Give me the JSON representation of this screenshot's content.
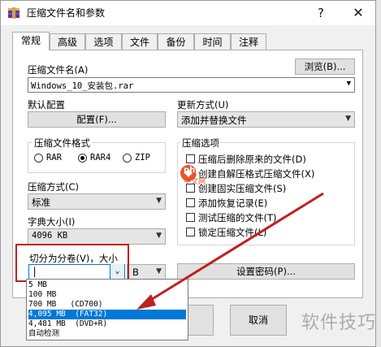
{
  "window": {
    "title": "压缩文件名和参数",
    "help_glyph": "?",
    "close_glyph": "✕"
  },
  "tabs": [
    {
      "label": "常规",
      "active": true
    },
    {
      "label": "高级"
    },
    {
      "label": "选项"
    },
    {
      "label": "文件"
    },
    {
      "label": "备份"
    },
    {
      "label": "时间"
    },
    {
      "label": "注释"
    }
  ],
  "archive_name": {
    "label": "压缩文件名(A)",
    "value": "Windows_10_安装包.rar",
    "browse_label": "浏览(B)..."
  },
  "default_profile": {
    "label": "默认配置",
    "button_label": "配置(F)..."
  },
  "update_mode": {
    "label": "更新方式(U)",
    "value": "添加并替换文件"
  },
  "archive_format": {
    "label": "压缩文件格式",
    "options": [
      {
        "label": "RAR",
        "checked": false
      },
      {
        "label": "RAR4",
        "checked": true
      },
      {
        "label": "ZIP",
        "checked": false
      }
    ]
  },
  "compression_method": {
    "label": "压缩方式(C)",
    "value": "标准"
  },
  "dictionary_size": {
    "label": "字典大小(I)",
    "value": "4096 KB"
  },
  "split_volumes": {
    "label": "切分为分卷(V)，大小",
    "value": "",
    "unit_value": "B",
    "dropdown_options": [
      {
        "label": "5 MB",
        "selected": false
      },
      {
        "label": "100 MB",
        "selected": false
      },
      {
        "label": "700 MB   (CD700)",
        "selected": false
      },
      {
        "label": "4,095 MB  (FAT32)",
        "selected": true
      },
      {
        "label": "4,481 MB  (DVD+R)",
        "selected": false
      },
      {
        "label": "自动检测",
        "selected": false
      }
    ]
  },
  "options_group": {
    "label": "压缩选项",
    "items": [
      {
        "label": "压缩后删除原来的文件(D)",
        "checked": false
      },
      {
        "label": "创建自解压格式压缩文件(X)",
        "checked": false
      },
      {
        "label": "创建固实压缩文件(S)",
        "checked": false
      },
      {
        "label": "添加恢复记录(E)",
        "checked": false
      },
      {
        "label": "测试压缩的文件(T)",
        "checked": false
      },
      {
        "label": "锁定压缩文件(L)",
        "checked": false
      }
    ]
  },
  "set_password_label": "设置密码(P)...",
  "footer": {
    "cancel_label": "取消"
  },
  "watermark": {
    "logo_text": "php",
    "logo_sub": "中文网",
    "text": "软件技巧"
  },
  "colors": {
    "accent_selection": "#0078d7",
    "annotation_red": "#c0201e",
    "watermark_orange": "#e8542a"
  }
}
